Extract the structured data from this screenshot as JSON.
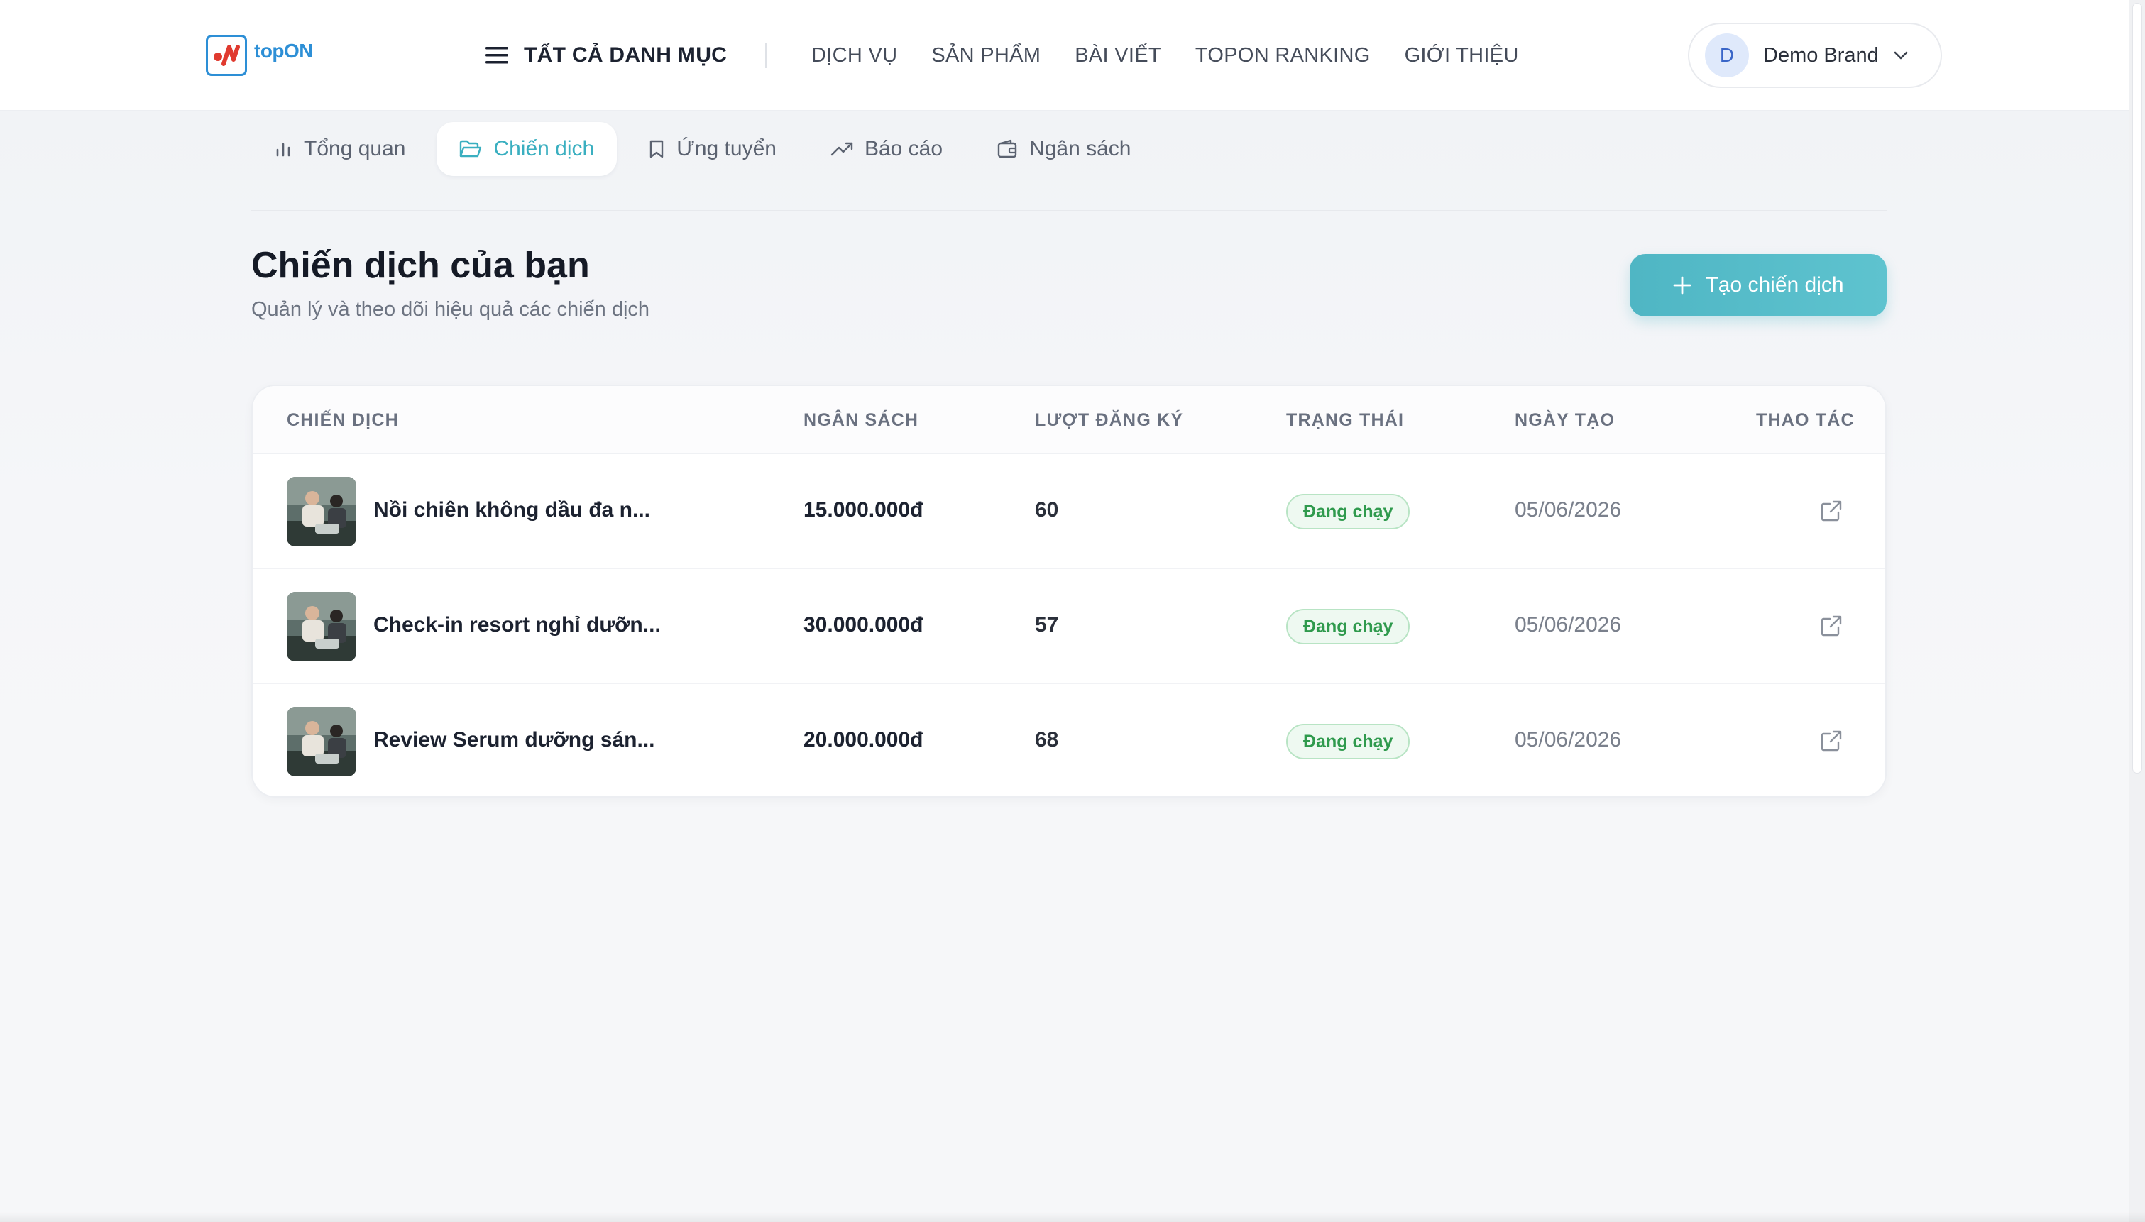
{
  "header": {
    "logo_text": "topON",
    "all_categories": "TẤT CẢ DANH MỤC",
    "nav": [
      "DỊCH VỤ",
      "SẢN PHẨM",
      "BÀI VIẾT",
      "TOPON RANKING",
      "GIỚI THIỆU"
    ],
    "user": {
      "initial": "D",
      "name": "Demo Brand"
    }
  },
  "tabs": [
    {
      "label": "Tổng quan",
      "icon": "bar-chart-icon",
      "active": false
    },
    {
      "label": "Chiến dịch",
      "icon": "folder-open-icon",
      "active": true
    },
    {
      "label": "Ứng tuyển",
      "icon": "bookmark-icon",
      "active": false
    },
    {
      "label": "Báo cáo",
      "icon": "trend-up-icon",
      "active": false
    },
    {
      "label": "Ngân sách",
      "icon": "wallet-icon",
      "active": false
    }
  ],
  "main": {
    "title": "Chiến dịch của bạn",
    "subtitle": "Quản lý và theo dõi hiệu quả các chiến dịch",
    "create_button": "Tạo chiến dịch"
  },
  "table": {
    "columns": [
      "CHIẾN DỊCH",
      "NGÂN SÁCH",
      "LƯỢT ĐĂNG KÝ",
      "TRẠNG THÁI",
      "NGÀY TẠO",
      "THAO TÁC"
    ],
    "rows": [
      {
        "name": "Nồi chiên không dầu đa n...",
        "budget": "15.000.000đ",
        "registrations": "60",
        "status": "Đang chạy",
        "created": "05/06/2026"
      },
      {
        "name": "Check-in resort nghỉ dưỡn...",
        "budget": "30.000.000đ",
        "registrations": "57",
        "status": "Đang chạy",
        "created": "05/06/2026"
      },
      {
        "name": "Review Serum dưỡng sán...",
        "budget": "20.000.000đ",
        "registrations": "68",
        "status": "Đang chạy",
        "created": "05/06/2026"
      }
    ]
  },
  "colors": {
    "accent": "#4fb6c4",
    "status_green": "#2f9a4d",
    "logo_blue": "#2d8fd6",
    "logo_red": "#e03a2f"
  }
}
